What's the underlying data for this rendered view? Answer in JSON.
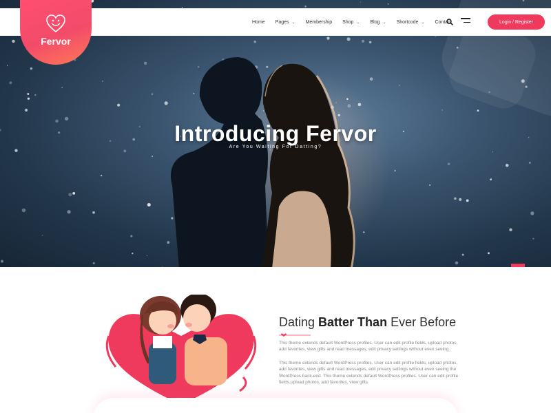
{
  "brand": {
    "name": "Fervor",
    "color": "#ef3a5d"
  },
  "nav": {
    "items": [
      {
        "label": "Home",
        "dropdown": false
      },
      {
        "label": "Pages",
        "dropdown": true
      },
      {
        "label": "Membership",
        "dropdown": false
      },
      {
        "label": "Shop",
        "dropdown": true
      },
      {
        "label": "Blog",
        "dropdown": true
      },
      {
        "label": "Shortcode",
        "dropdown": true
      },
      {
        "label": "Contact",
        "dropdown": false
      }
    ],
    "search_icon": "search-icon",
    "menu_icon": "hamburger-icon",
    "login_label": "Login / Register"
  },
  "hero": {
    "title": "Introducing Fervor",
    "subtitle": "Are You Waiting For Datting?"
  },
  "intro": {
    "title_pre": "Dating ",
    "title_bold": "Batter Than",
    "title_post": " Ever Before",
    "para1": "This theme extends default WordPress profiles. User can edit profile fields, upload photos, add favorites, view gifts and read messages, edit privacy settings without even seeing .",
    "para2": "This theme extends default WordPress profiles. User can edit profile fields, upload photos, add favorites, view gifts and read messages, edit privacy settings without even seeing the WordPress back-end. This theme extends default WordPress profiles. User can edit profile fields,upload photos, add favorites, view gifts"
  }
}
